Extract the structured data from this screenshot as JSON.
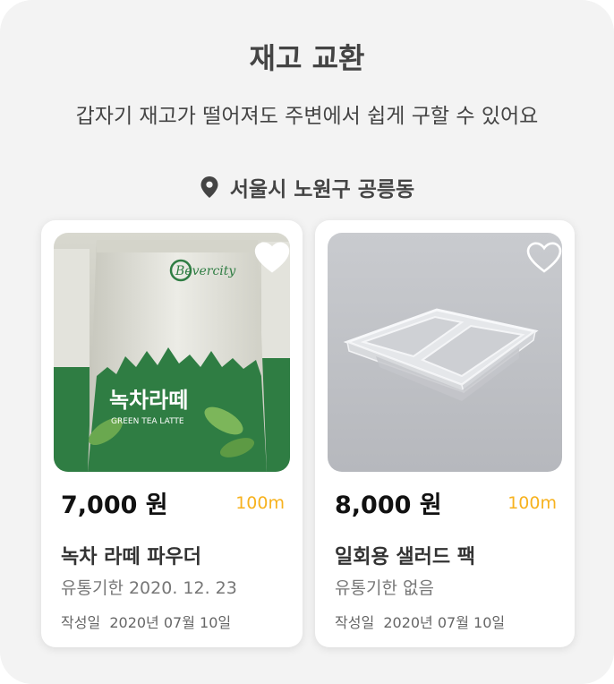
{
  "header": {
    "title": "재고 교환",
    "subtitle": "갑자기 재고가 떨어져도 주변에서 쉽게 구할 수 있어요",
    "location": "서울시 노원구 공릉동"
  },
  "products": [
    {
      "price": "7,000 원",
      "distance": "100m",
      "name": "녹차 라떼 파우더",
      "expiry": "유통기한 2020. 12. 23",
      "date": "작성일  2020년 07월 10일",
      "liked": true,
      "image_icon": "green-tea-latte-package",
      "package_brand": "Bevercity",
      "package_label": "녹차라떼",
      "package_sublabel": "GREEN TEA LATTE"
    },
    {
      "price": "8,000 원",
      "distance": "100m",
      "name": "일회용 샐러드 팩",
      "expiry": "유통기한 없음",
      "date": "작성일  2020년 07월 10일",
      "liked": false,
      "image_icon": "plastic-salad-container"
    }
  ],
  "colors": {
    "accent": "#f7b21e",
    "background": "#f3f3f3",
    "card": "#ffffff",
    "package_green": "#2f7d43"
  }
}
